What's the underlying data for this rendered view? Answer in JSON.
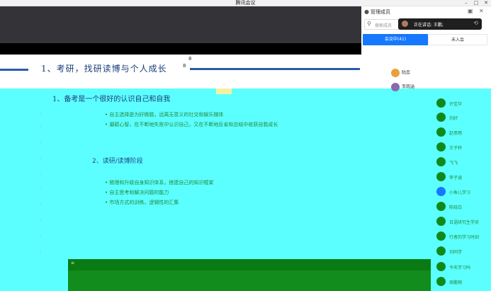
{
  "window": {
    "title": "腾讯会议",
    "controls": [
      "–",
      "□",
      "✕"
    ]
  },
  "slide": {
    "title": "1、考研，找研读博与个人成长",
    "title_mark_1": "8",
    "title_mark_2": "8",
    "subtitle": "1、备考是一个很好的认识自己和自我",
    "bullets_1": [
      "• 自主选择是为好做题，远离无意义的社交和娱乐媒体",
      "• 磨砺心智，在不断地失败中认识自己，又在不断地反省和总结中收获自我成长"
    ],
    "section_2": "2、读研/读博阶段",
    "bullets_2": [
      "• 梳理和升级自身知识体系，搭建自己的知识框架",
      "• 自主思考和解决问题的能力",
      "• 市场方式的训练，逻辑性的汇集"
    ],
    "left_marks": [
      "/",
      "/",
      "/",
      "/",
      "/",
      "/",
      "/",
      "/",
      "/",
      "/",
      "/",
      "/",
      "/"
    ],
    "green_bar_mark": "≡"
  },
  "panel": {
    "title": "管理成员",
    "search_placeholder": "搜索成员",
    "speaking_text": "正在讲话: 王鹏;",
    "tabs": {
      "active": "会议中(41)",
      "idle": "未入会"
    },
    "top_members": [
      {
        "name": "陆蕊",
        "color": "#e8a23a"
      },
      {
        "name": "李雨涵",
        "color": "#8a6aa8"
      }
    ],
    "members": [
      "许佳华",
      "刘好",
      "赵思雨",
      "王子轩",
      "飞飞",
      "李子涵",
      "小鱼儿学习",
      "陈晓白",
      "日语研究生学员",
      "行者的学习时刻",
      "刘同学",
      "今天学习吗",
      "周鹏翔"
    ]
  }
}
